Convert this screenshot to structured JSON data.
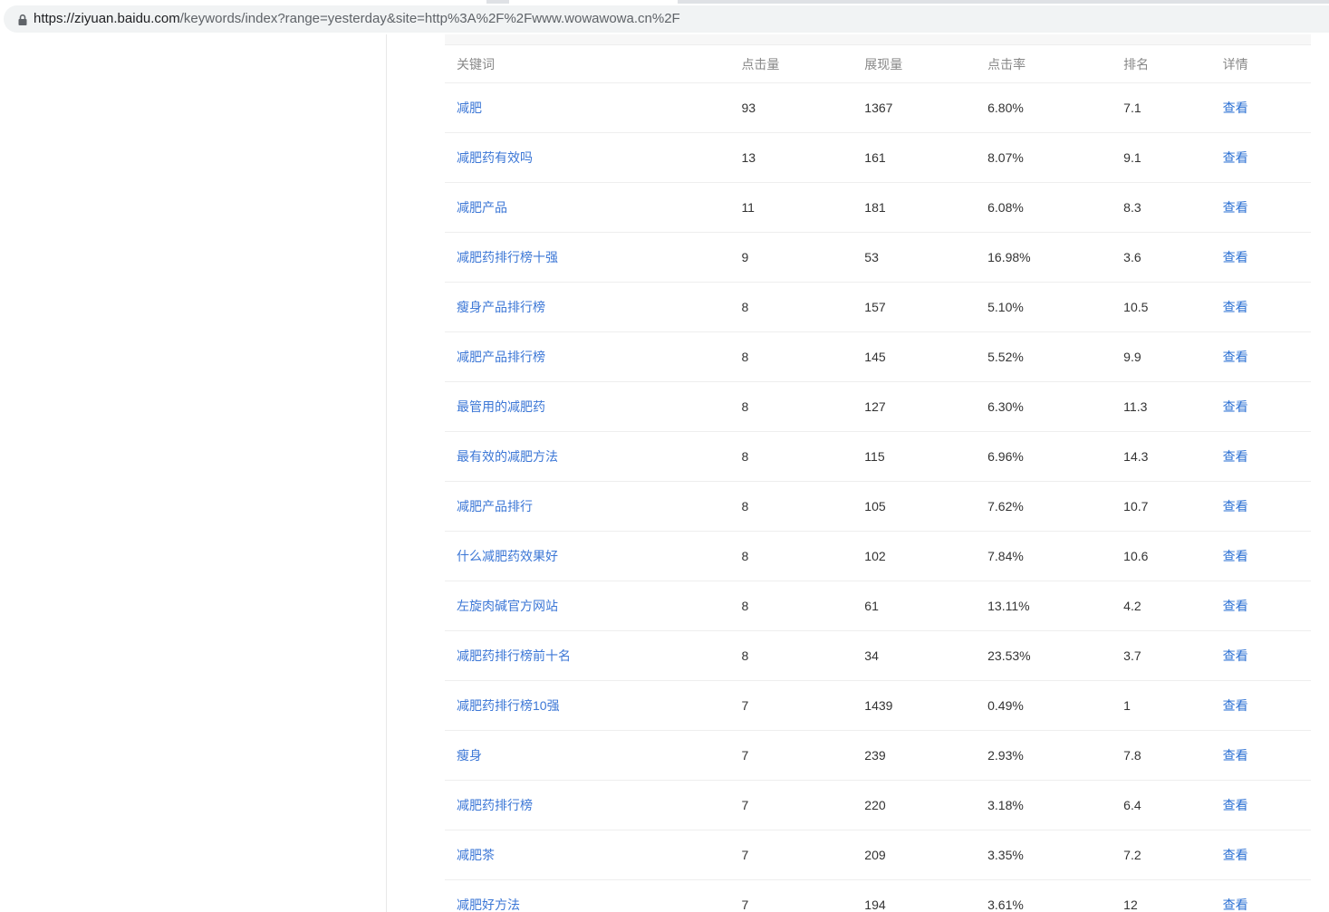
{
  "browser": {
    "url_host": "https://ziyuan.baidu.com",
    "url_path": "/keywords/index?range=yesterday&site=http%3A%2F%2Fwww.wowawowa.cn%2F"
  },
  "table": {
    "headers": {
      "keyword": "关键词",
      "clicks": "点击量",
      "impressions": "展现量",
      "ctr": "点击率",
      "rank": "排名",
      "detail": "详情"
    },
    "rows": [
      {
        "keyword": "减肥",
        "clicks": "93",
        "impressions": "1367",
        "ctr": "6.80%",
        "rank": "7.1",
        "detail": "查看"
      },
      {
        "keyword": "减肥药有效吗",
        "clicks": "13",
        "impressions": "161",
        "ctr": "8.07%",
        "rank": "9.1",
        "detail": "查看"
      },
      {
        "keyword": "减肥产品",
        "clicks": "11",
        "impressions": "181",
        "ctr": "6.08%",
        "rank": "8.3",
        "detail": "查看"
      },
      {
        "keyword": "减肥药排行榜十强",
        "clicks": "9",
        "impressions": "53",
        "ctr": "16.98%",
        "rank": "3.6",
        "detail": "查看"
      },
      {
        "keyword": "瘦身产品排行榜",
        "clicks": "8",
        "impressions": "157",
        "ctr": "5.10%",
        "rank": "10.5",
        "detail": "查看"
      },
      {
        "keyword": "减肥产品排行榜",
        "clicks": "8",
        "impressions": "145",
        "ctr": "5.52%",
        "rank": "9.9",
        "detail": "查看"
      },
      {
        "keyword": "最管用的减肥药",
        "clicks": "8",
        "impressions": "127",
        "ctr": "6.30%",
        "rank": "11.3",
        "detail": "查看"
      },
      {
        "keyword": "最有效的减肥方法",
        "clicks": "8",
        "impressions": "115",
        "ctr": "6.96%",
        "rank": "14.3",
        "detail": "查看"
      },
      {
        "keyword": "减肥产品排行",
        "clicks": "8",
        "impressions": "105",
        "ctr": "7.62%",
        "rank": "10.7",
        "detail": "查看"
      },
      {
        "keyword": "什么减肥药效果好",
        "clicks": "8",
        "impressions": "102",
        "ctr": "7.84%",
        "rank": "10.6",
        "detail": "查看"
      },
      {
        "keyword": "左旋肉碱官方网站",
        "clicks": "8",
        "impressions": "61",
        "ctr": "13.11%",
        "rank": "4.2",
        "detail": "查看"
      },
      {
        "keyword": "减肥药排行榜前十名",
        "clicks": "8",
        "impressions": "34",
        "ctr": "23.53%",
        "rank": "3.7",
        "detail": "查看"
      },
      {
        "keyword": "减肥药排行榜10强",
        "clicks": "7",
        "impressions": "1439",
        "ctr": "0.49%",
        "rank": "1",
        "detail": "查看"
      },
      {
        "keyword": "瘦身",
        "clicks": "7",
        "impressions": "239",
        "ctr": "2.93%",
        "rank": "7.8",
        "detail": "查看"
      },
      {
        "keyword": "减肥药排行榜",
        "clicks": "7",
        "impressions": "220",
        "ctr": "3.18%",
        "rank": "6.4",
        "detail": "查看"
      },
      {
        "keyword": "减肥茶",
        "clicks": "7",
        "impressions": "209",
        "ctr": "3.35%",
        "rank": "7.2",
        "detail": "查看"
      },
      {
        "keyword": "减肥好方法",
        "clicks": "7",
        "impressions": "194",
        "ctr": "3.61%",
        "rank": "12",
        "detail": "查看"
      }
    ]
  },
  "colors": {
    "link": "#3c77d6",
    "detail_link": "#2a6fd3",
    "header_text": "#888888",
    "row_border": "#eeeeee"
  }
}
